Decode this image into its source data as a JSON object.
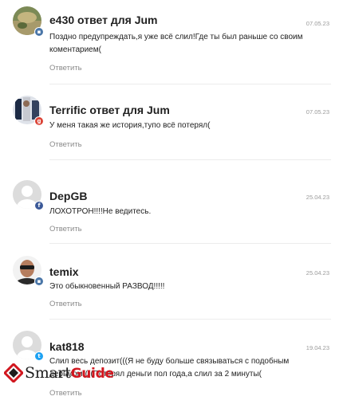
{
  "comments": [
    {
      "author": "e430",
      "reply_prefix": " ответ для ",
      "reply_to": "Jum",
      "date": "07.05.23",
      "text": "Поздно предупреждать,я уже всё слил!Где ты был раньше со своим коментарием(",
      "reply_label": "Ответить",
      "network": "vk",
      "badge_color": "#4a76a8"
    },
    {
      "author": "Terrific",
      "reply_prefix": " ответ для ",
      "reply_to": "Jum",
      "date": "07.05.23",
      "text": "У меня такая же история,тупо всё потерял(",
      "reply_label": "Ответить",
      "network": "google",
      "badge_color": "#db4437"
    },
    {
      "author": "DepGB",
      "date": "25.04.23",
      "text": "ЛОХОТРОН!!!!Не ведитесь.",
      "reply_label": "Ответить",
      "network": "facebook",
      "badge_color": "#3b5998"
    },
    {
      "author": "temix",
      "date": "25.04.23",
      "text": "Это обыкновенный РАЗВОД!!!!!",
      "reply_label": "Ответить",
      "network": "vk",
      "badge_color": "#4a76a8"
    },
    {
      "author": "kat818",
      "date": "19.04.23",
      "text": "Слил весь депозит(((Я не буду больше связываться с подобным дерьмом((((Потерял деньги пол года,а слил за 2 минуты(",
      "reply_label": "Ответить",
      "network": "twitter",
      "badge_color": "#1da1f2"
    }
  ],
  "watermark": {
    "brand_part1": "Smart",
    "brand_part2": "Guide",
    "accent_color": "#d1171f"
  }
}
